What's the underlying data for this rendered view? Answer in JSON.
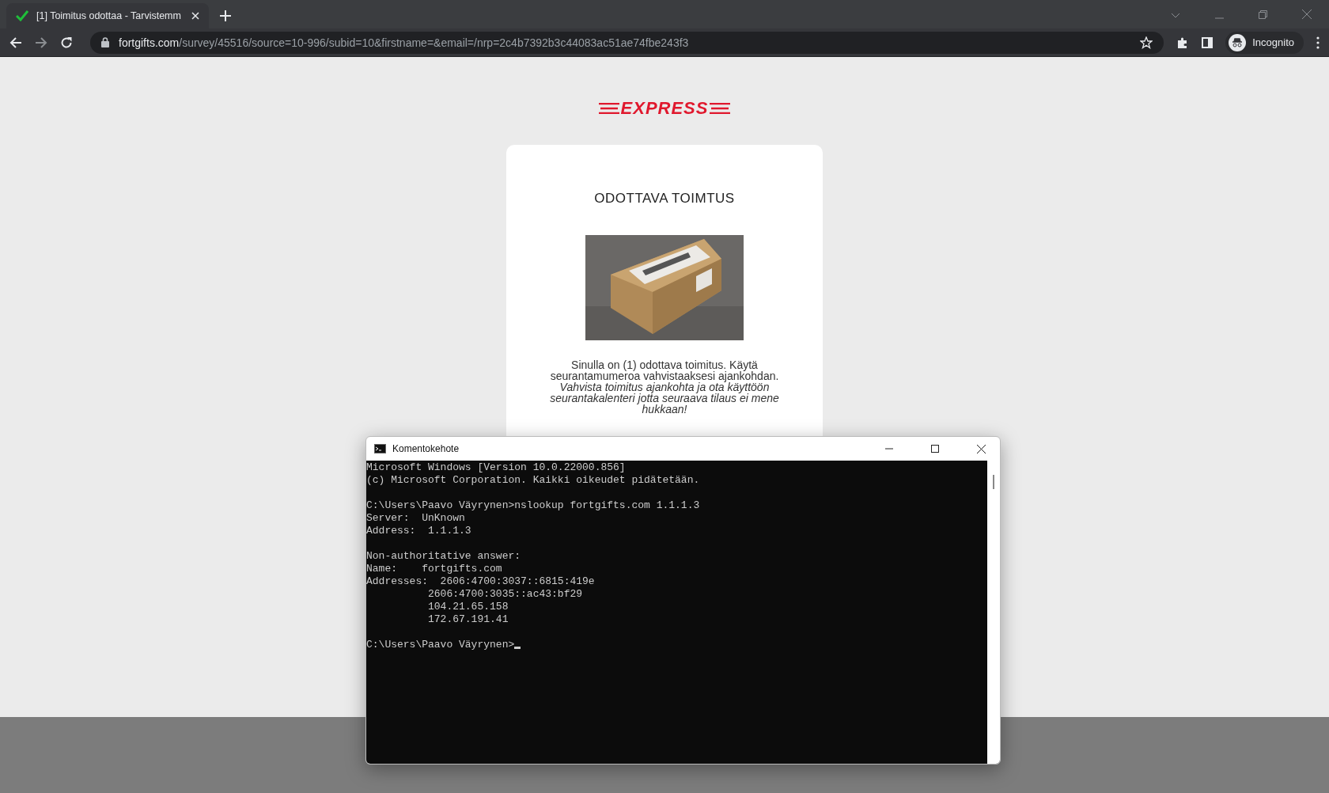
{
  "browser": {
    "tab": {
      "title": "[1] Toimitus odottaa - Tarvistemm",
      "selected": true
    },
    "url": {
      "domain": "fortgifts.com",
      "path": "/survey/45516/source=10-996/subid=10&firstname=&email=/nrp=2c4b7392b3c44083ac51ae74fbe243f3"
    },
    "profile": "Incognito"
  },
  "page": {
    "logo": "EXPRESS",
    "heading": "ODOTTAVA TOIMTUS",
    "message": "Sinulla on (1) odottava toimitus. Käytä seurantamumeroa vahvistaaksesi ajankohdan.",
    "note": "Vahvista toimitus ajankohta ja ota käyttöön seurantakalenteri jotta seuraava tilaus ei mene hukkaan!"
  },
  "console": {
    "title": "Komentokehote",
    "blocks": [
      [
        "Microsoft Windows [Version 10.0.22000.856]",
        "(c) Microsoft Corporation. Kaikki oikeudet pidätetään."
      ],
      [
        "C:\\Users\\Paavo Väyrynen>nslookup fortgifts.com 1.1.1.3",
        "Server:  UnKnown",
        "Address:  1.1.1.3"
      ],
      [
        "Non-authoritative answer:",
        "Name:    fortgifts.com",
        "Addresses:  2606:4700:3037::6815:419e",
        "          2606:4700:3035::ac43:bf29",
        "          104.21.65.158",
        "          172.67.191.41"
      ]
    ],
    "prompt": "C:\\Users\\Paavo Väyrynen>"
  }
}
